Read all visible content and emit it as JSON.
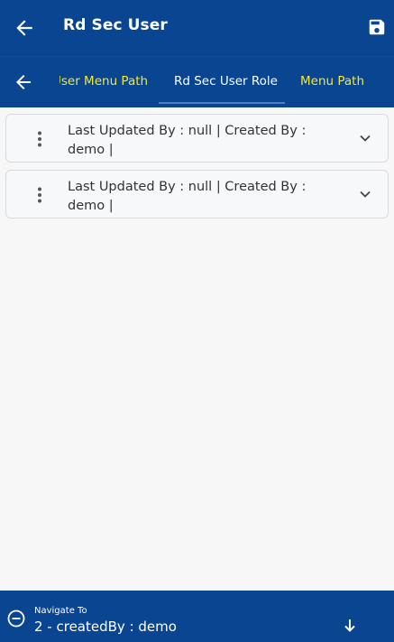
{
  "header": {
    "title": "Rd Sec User"
  },
  "tabs": {
    "prev_label": "User Menu Path",
    "active_label": "Rd Sec User Role",
    "next_label": "Menu Path"
  },
  "records": [
    {
      "text": "Last Updated By  : null | Created By  : demo |"
    },
    {
      "text": "Last Updated By  : null | Created By  : demo |"
    }
  ],
  "navigate": {
    "label": "Navigate To",
    "value": "2 - createdBy : demo"
  },
  "colors": {
    "primary": "#0a4592",
    "tab_highlight": "#f2e937",
    "background": "#f7f7f8",
    "card_border": "#d7dadf"
  },
  "icons": [
    "arrow-left-icon",
    "save-icon",
    "kebab-icon",
    "chevron-down-icon",
    "minus-circle-icon",
    "arrow-down-icon"
  ]
}
